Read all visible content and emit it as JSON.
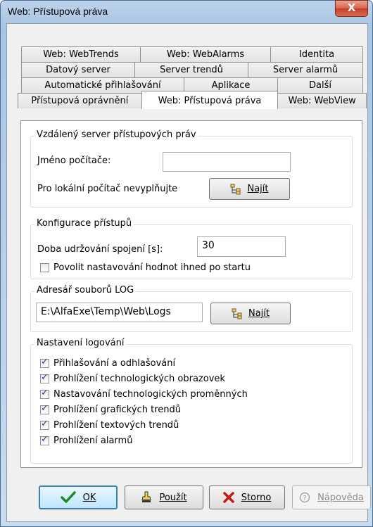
{
  "window": {
    "title": "Web: Přístupová práva",
    "close_glyph": "X"
  },
  "tabs": {
    "row1": [
      "Web: WebTrends",
      "Web: WebAlarms",
      "Identita"
    ],
    "row2": [
      "Datový server",
      "Server trendů",
      "Server alarmů"
    ],
    "row3": [
      "Automatické přihlašování",
      "Aplikace",
      "Další"
    ],
    "row4": [
      "Přístupová oprávnění",
      "Web: Přístupová práva",
      "Web: WebView"
    ],
    "active": "Web: Přístupová práva"
  },
  "remote_server": {
    "legend": "Vzdálený server přístupových práv",
    "computer_name_label": "Jméno počítače:",
    "computer_name_value": "",
    "hint": "Pro lokální počítač nevyplňujte",
    "find_label": "Najít",
    "find_icon": "folder-tree-icon"
  },
  "access_config": {
    "legend": "Konfigurace přístupů",
    "keepalive_label": "Doba udržování spojení [s]:",
    "keepalive_value": "30",
    "allow_after_start_label": "Povolit nastavování hodnot ihned po startu",
    "allow_after_start_checked": false
  },
  "log_dir": {
    "legend": "Adresář souborů LOG",
    "path": "E:\\AlfaExe\\Temp\\Web\\Logs",
    "find_label": "Najít"
  },
  "logging": {
    "legend": "Nastavení logování",
    "options": [
      {
        "label": "Přihlašování a odhlašování",
        "checked": true
      },
      {
        "label": "Prohlížení technologických obrazovek",
        "checked": true
      },
      {
        "label": "Nastavování technologických proměnných",
        "checked": true
      },
      {
        "label": "Prohlížení grafických trendů",
        "checked": true
      },
      {
        "label": "Prohlížení textových trendů",
        "checked": true
      },
      {
        "label": "Prohlížení alarmů",
        "checked": true
      }
    ]
  },
  "buttons": {
    "ok": "OK",
    "apply": "Použít",
    "cancel": "Storno",
    "help": "Nápověda"
  },
  "colors": {
    "ok_check": "#1e8a1e",
    "cancel_x": "#c01b1b",
    "title_bar": "#b9d1ea"
  }
}
